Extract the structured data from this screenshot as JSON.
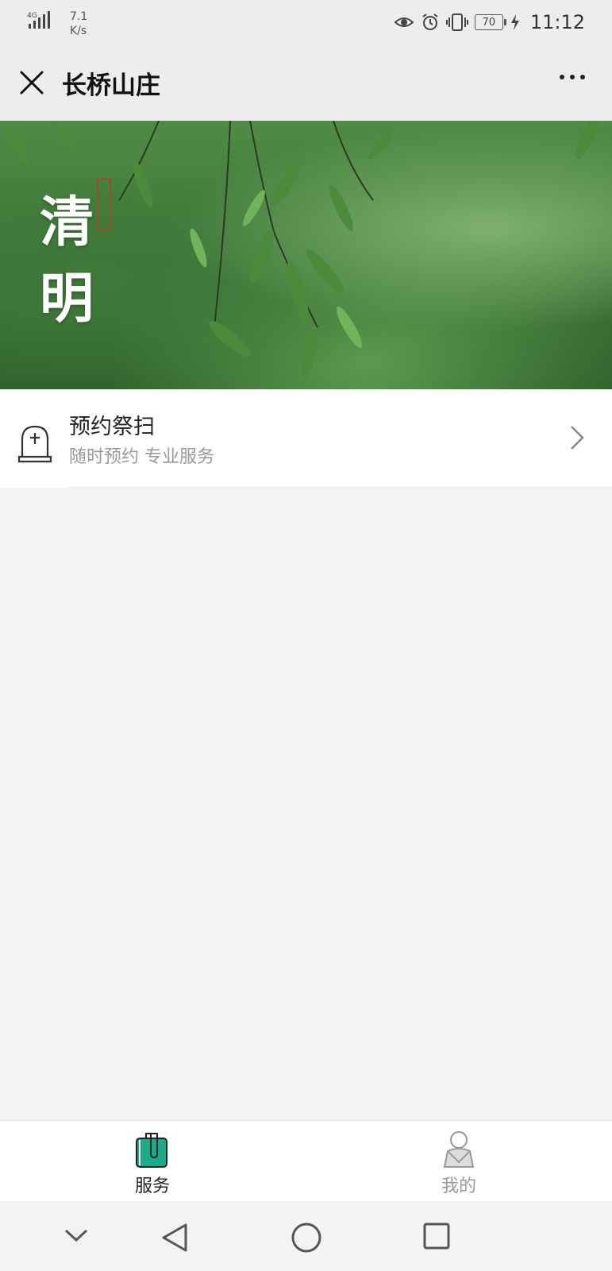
{
  "status_bar": {
    "signal": "4G",
    "net_speed_value": "7.1",
    "net_speed_unit": "K/s",
    "battery": "70",
    "time": "11:12",
    "icons": [
      "eye-icon",
      "alarm-icon",
      "vibrate-icon",
      "battery-icon",
      "charging-icon"
    ]
  },
  "nav": {
    "title": "长桥山庄"
  },
  "banner": {
    "text_line1": "清",
    "text_line2": "明"
  },
  "list": [
    {
      "title": "预约祭扫",
      "subtitle": "随时预约 专业服务",
      "icon": "tombstone-icon"
    }
  ],
  "tabs": [
    {
      "label": "服务",
      "icon": "service-bag-icon",
      "active": true
    },
    {
      "label": "我的",
      "icon": "profile-icon",
      "active": false
    }
  ],
  "colors": {
    "accent": "#1aab8a",
    "background": "#f3f3f3",
    "navbar": "#ededed"
  }
}
